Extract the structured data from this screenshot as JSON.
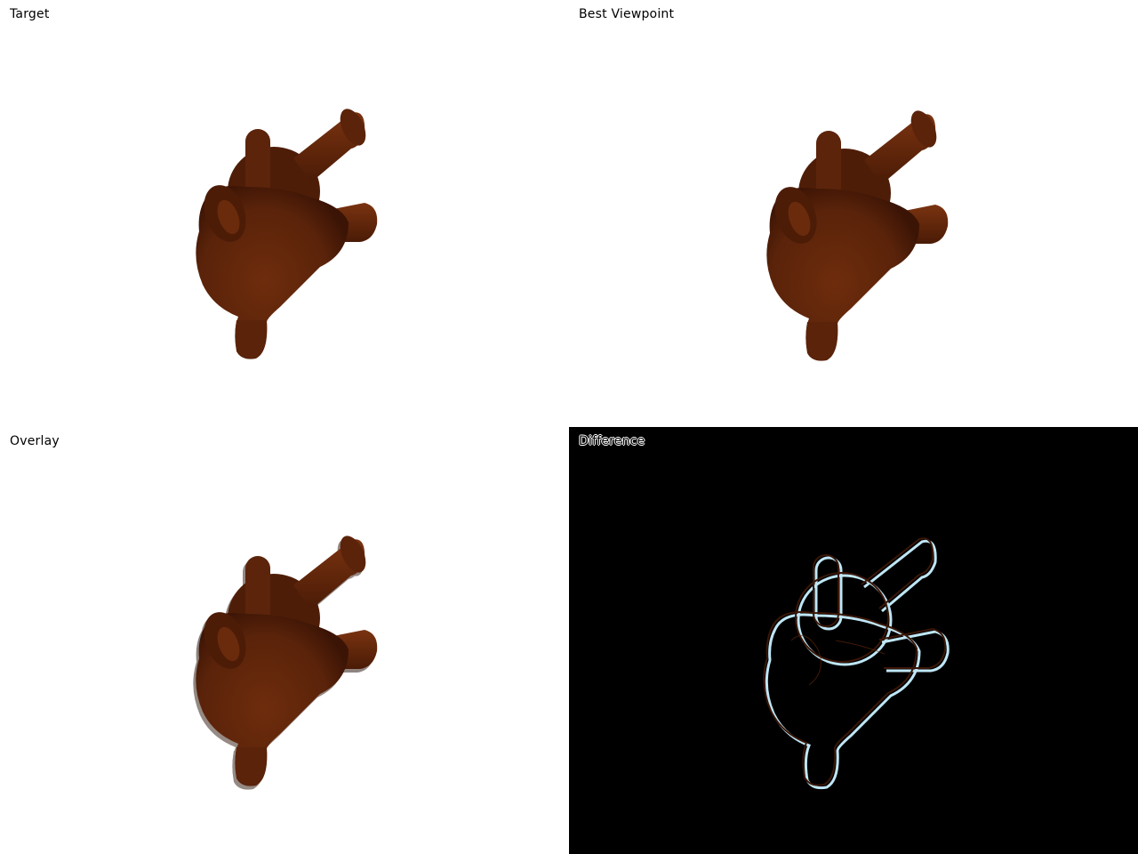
{
  "panels": {
    "target": {
      "label": "Target"
    },
    "best_viewpoint": {
      "label": "Best Viewpoint"
    },
    "overlay": {
      "label": "Overlay"
    },
    "difference": {
      "label": "Difference"
    }
  },
  "colors": {
    "model_dark": "#3a1606",
    "model_mid": "#6b2c0c",
    "model_light": "#8a3d14",
    "shadow_gray": "#8c7a72",
    "edge_highlight": "#bfe6f5",
    "diff_background": "#000000"
  }
}
